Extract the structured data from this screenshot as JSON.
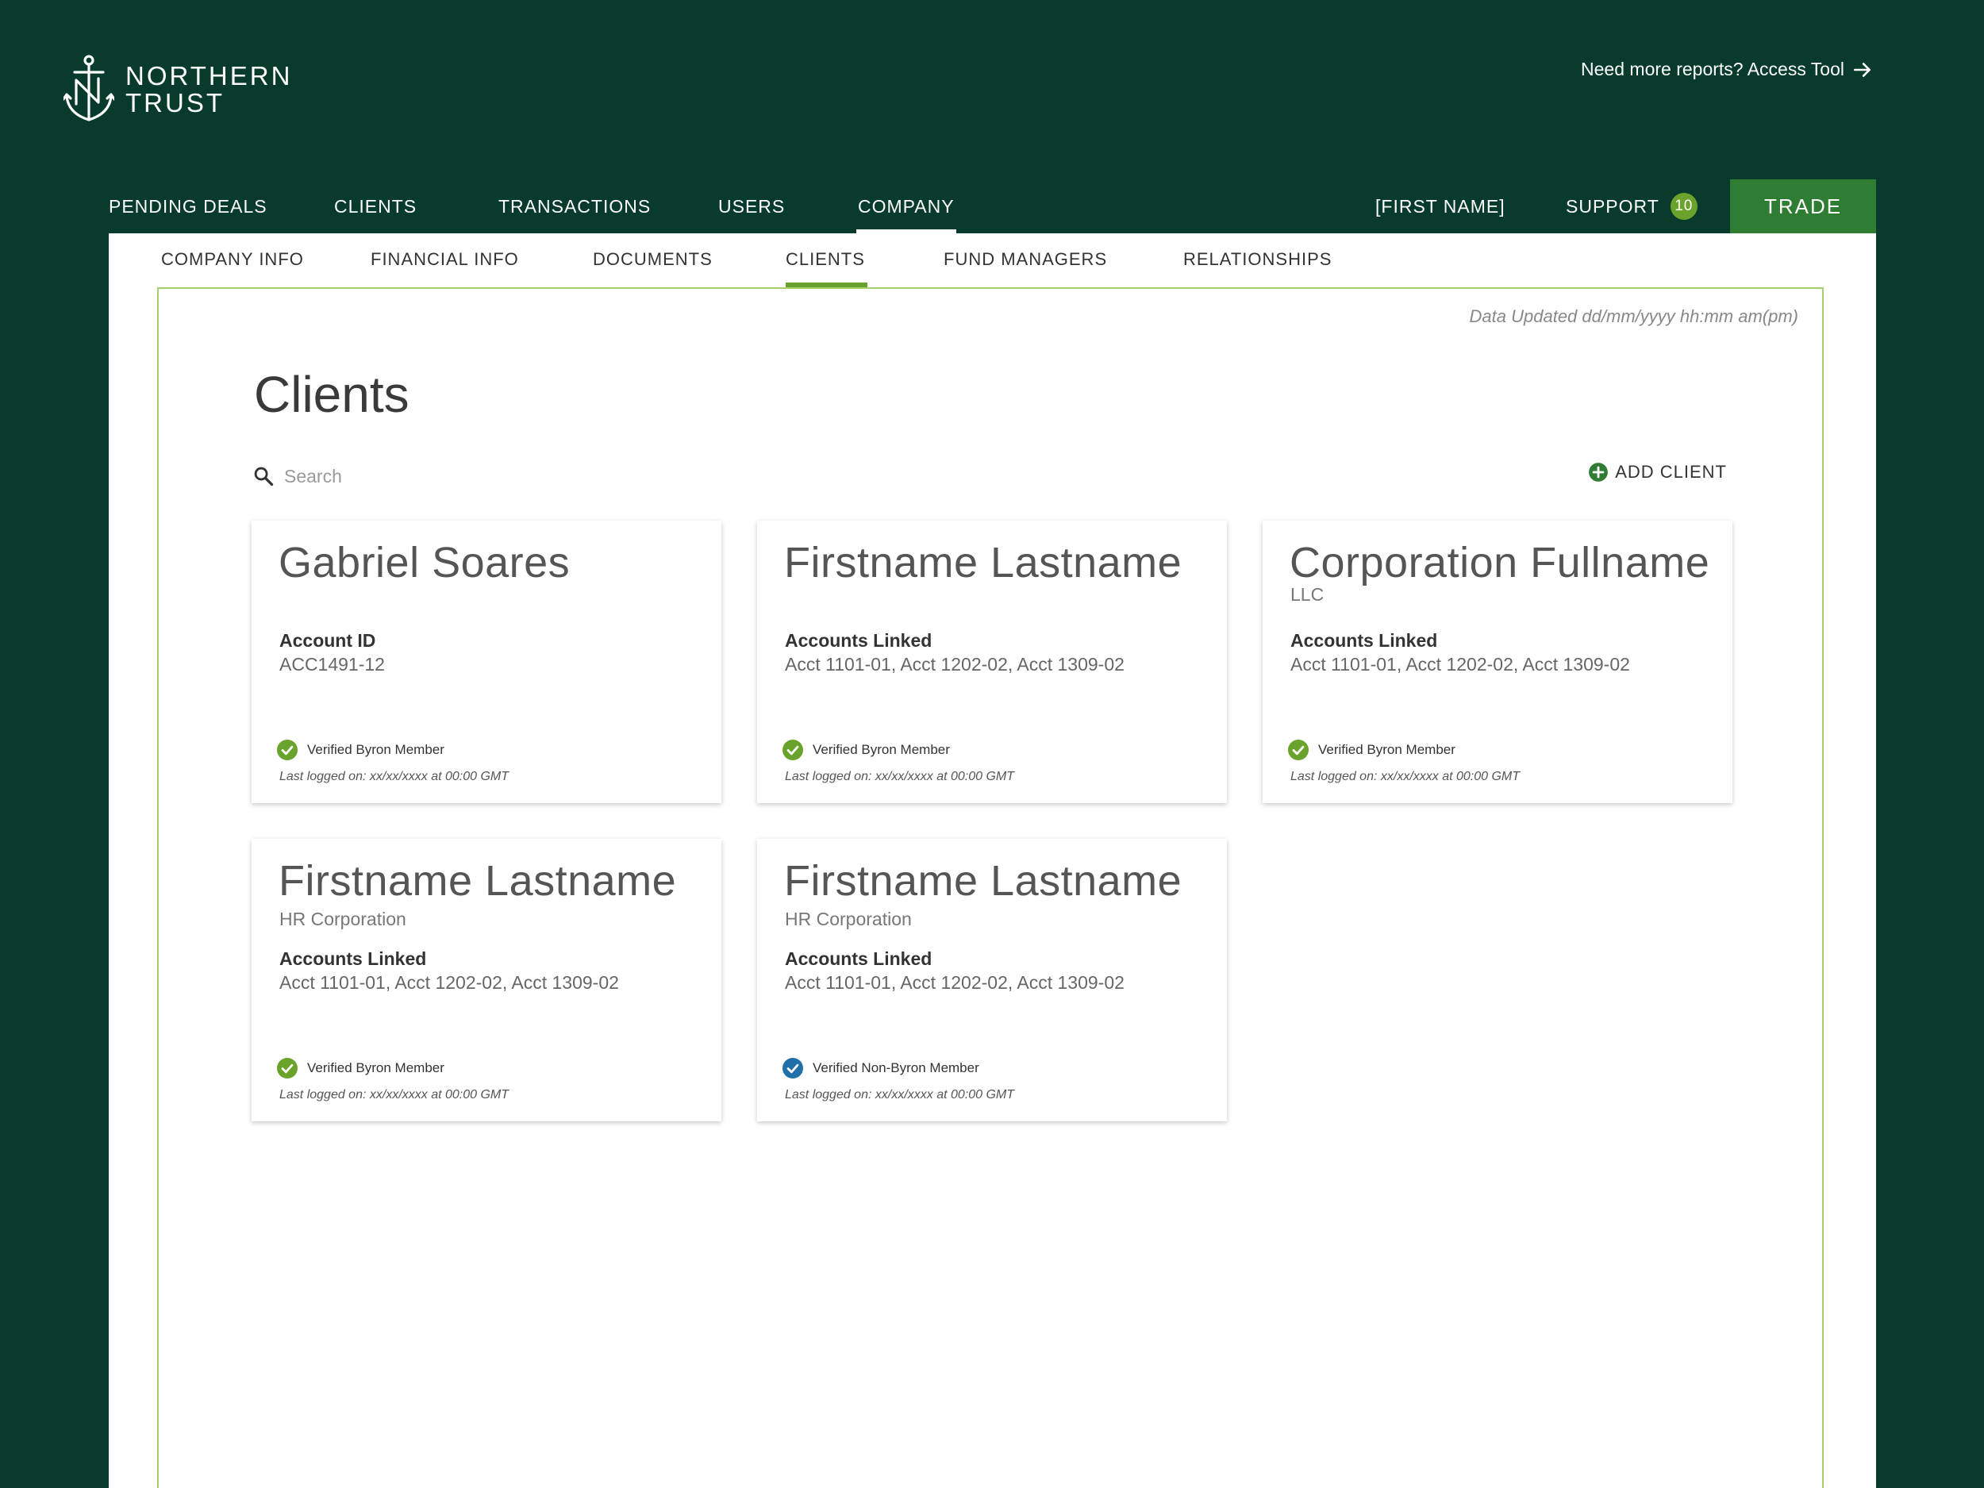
{
  "brand": {
    "line1": "NORTHERN",
    "line2": "TRUST"
  },
  "header": {
    "access_link": "Need more reports? Access Tool"
  },
  "main_nav": {
    "items": [
      {
        "label": "PENDING DEALS"
      },
      {
        "label": "CLIENTS"
      },
      {
        "label": "TRANSACTIONS"
      },
      {
        "label": "USERS"
      },
      {
        "label": "COMPANY",
        "active": true
      }
    ],
    "user_label": "[FIRST NAME]",
    "support_label": "SUPPORT",
    "support_count": "10",
    "trade_label": "TRADE"
  },
  "sub_nav": {
    "items": [
      {
        "label": "COMPANY INFO"
      },
      {
        "label": "FINANCIAL INFO"
      },
      {
        "label": "DOCUMENTS"
      },
      {
        "label": "CLIENTS",
        "active": true
      },
      {
        "label": "FUND MANAGERS"
      },
      {
        "label": "RELATIONSHIPS"
      }
    ]
  },
  "page": {
    "data_updated": "Data Updated dd/mm/yyyy hh:mm am(pm)",
    "title": "Clients",
    "search_placeholder": "Search",
    "add_client_label": "ADD CLIENT"
  },
  "colors": {
    "background": "#083b2c",
    "accent_green": "#6aa32b",
    "trade_green": "#2f7d32",
    "verified_blue": "#1f6fa8"
  },
  "cards": [
    {
      "name": "Gabriel Soares",
      "subtitle": "",
      "label": "Account ID",
      "value": "ACC1491-12",
      "status": "Verified Byron Member",
      "status_type": "byron",
      "last_logged": "Last logged on: xx/xx/xxxx at 00:00 GMT"
    },
    {
      "name": "Firstname Lastname",
      "subtitle": "",
      "label": "Accounts Linked",
      "value": "Acct 1101-01, Acct 1202-02, Acct 1309-02",
      "status": "Verified Byron Member",
      "status_type": "byron",
      "last_logged": "Last logged on: xx/xx/xxxx at 00:00 GMT"
    },
    {
      "name": "Corporation Fullname",
      "subtitle": "LLC",
      "label": "Accounts Linked",
      "value": "Acct 1101-01, Acct 1202-02, Acct 1309-02",
      "status": "Verified Byron Member",
      "status_type": "byron",
      "last_logged": "Last logged on: xx/xx/xxxx at 00:00 GMT"
    },
    {
      "name": "Firstname Lastname",
      "subtitle": "HR Corporation",
      "label": "Accounts Linked",
      "value": "Acct 1101-01, Acct 1202-02, Acct 1309-02",
      "status": "Verified Byron Member",
      "status_type": "byron",
      "last_logged": "Last logged on: xx/xx/xxxx at 00:00 GMT"
    },
    {
      "name": "Firstname Lastname",
      "subtitle": "HR Corporation",
      "label": "Accounts Linked",
      "value": "Acct 1101-01, Acct 1202-02, Acct 1309-02",
      "status": "Verified Non-Byron Member",
      "status_type": "non-byron",
      "last_logged": "Last logged on: xx/xx/xxxx at 00:00 GMT"
    }
  ]
}
